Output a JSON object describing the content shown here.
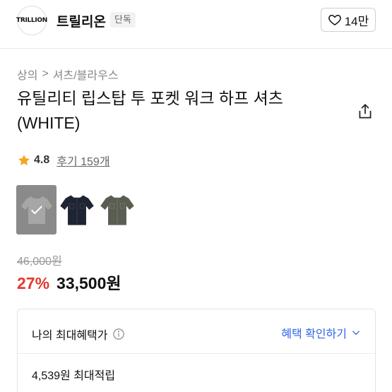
{
  "header": {
    "logo_text": "TRILLION",
    "brand_name": "트릴리온",
    "badge": "단독",
    "like_count": "14만"
  },
  "breadcrumb": {
    "level1": "상의",
    "separator": ">",
    "level2": "셔츠/블라우스"
  },
  "product": {
    "title": "유틸리티 립스탑 투 포켓 워크 하프 셔츠 (WHITE)",
    "rating": "4.8",
    "review_label": "후기 159개"
  },
  "swatches": [
    {
      "name": "white-gray",
      "color": "#9a9a9a",
      "selected": true
    },
    {
      "name": "navy",
      "color": "#1e2431",
      "selected": false
    },
    {
      "name": "olive",
      "color": "#5a5e52",
      "selected": false
    }
  ],
  "price": {
    "original": "46,000원",
    "discount": "27%",
    "sale": "33,500원"
  },
  "benefit": {
    "title": "나의 최대혜택가",
    "check_label": "혜택 확인하기",
    "points": "4,539원 최대적립"
  },
  "colors": {
    "discount_red": "#e33a2f",
    "link_blue": "#3065e8",
    "star_orange": "#f5a623"
  }
}
